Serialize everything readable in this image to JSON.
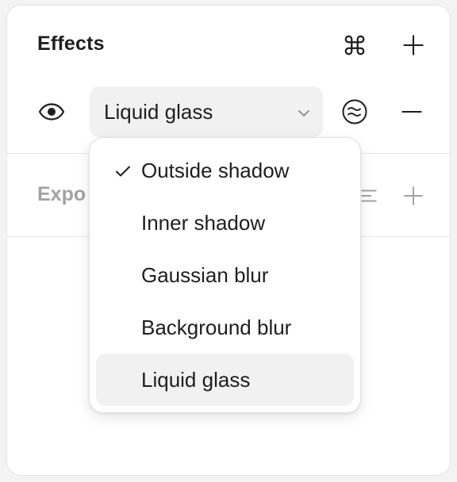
{
  "effects": {
    "title": "Effects",
    "icons": {
      "styles": "command-key-icon",
      "add": "plus-icon",
      "visibility": "eye-icon",
      "settings": "liquid-wave-icon",
      "remove": "minus-icon"
    },
    "selected_effect": "Liquid glass"
  },
  "export": {
    "title": "Expo",
    "icons": {
      "settings": "sliders-icon",
      "add": "plus-icon"
    }
  },
  "dropdown": {
    "items": [
      {
        "label": "Outside shadow",
        "checked": true,
        "highlighted": false
      },
      {
        "label": "Inner shadow",
        "checked": false,
        "highlighted": false
      },
      {
        "label": "Gaussian blur",
        "checked": false,
        "highlighted": false
      },
      {
        "label": "Background blur",
        "checked": false,
        "highlighted": false
      },
      {
        "label": "Liquid glass",
        "checked": false,
        "highlighted": true
      }
    ]
  },
  "colors": {
    "text": "#1e1e1e",
    "muted": "#a2a2a2",
    "field_bg": "#f1f1f1",
    "border": "#e3e3e3"
  }
}
